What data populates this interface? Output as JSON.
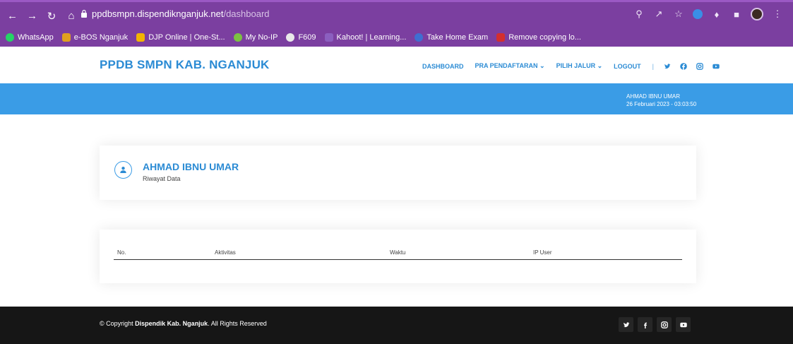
{
  "browser": {
    "url_host": "ppdbsmpn.dispendiknganjuk.net",
    "url_path": "/dashboard",
    "bookmarks": [
      {
        "label": "WhatsApp",
        "color": "#25d366"
      },
      {
        "label": "e-BOS Nganjuk",
        "color": "#e0a020"
      },
      {
        "label": "DJP Online | One-St...",
        "color": "#f2b400"
      },
      {
        "label": "My No-IP",
        "color": "#7cc142"
      },
      {
        "label": "F609",
        "color": "#e9e9e9"
      },
      {
        "label": "Kahoot! | Learning...",
        "color": "#8b5fbf"
      },
      {
        "label": "Take Home Exam",
        "color": "#3f6fd1"
      },
      {
        "label": "Remove copying lo...",
        "color": "#d32f2f"
      }
    ]
  },
  "site": {
    "logo": "PPDB SMPN KAB. NGANJUK",
    "nav": {
      "dashboard": "DASHBOARD",
      "pra_pendaftaran": "PRA PENDAFTARAN",
      "pilih_jalur": "PILIH JALUR",
      "logout": "LOGOUT",
      "separator": "|"
    },
    "accent": "#2b8bd4",
    "hero_color": "#3a9ce6"
  },
  "user": {
    "name": "AHMAD IBNU UMAR",
    "datetime": "26 Februari 2023 - 03:03:50"
  },
  "profile_card": {
    "name": "AHMAD IBNU UMAR",
    "subtitle": "Riwayat Data"
  },
  "table": {
    "columns": [
      "No.",
      "Aktivitas",
      "Waktu",
      "IP User"
    ],
    "rows": []
  },
  "footer": {
    "copyright_prefix": "© Copyright",
    "copyright_org": "Dispendik Kab. Nganjuk",
    "copyright_suffix": ". All Rights Reserved"
  }
}
